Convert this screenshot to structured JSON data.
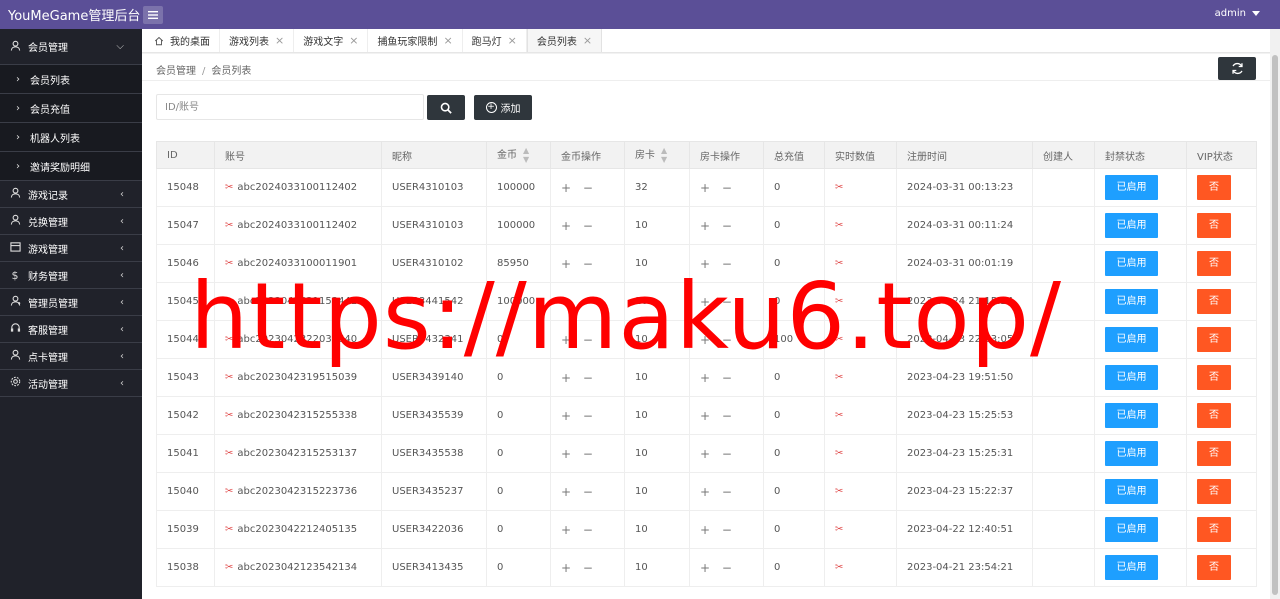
{
  "app": {
    "title": "YouMeGame管理后台",
    "user": "admin"
  },
  "sidebar": {
    "groups": [
      {
        "label": "会员管理",
        "icon": "user-icon",
        "open": true,
        "items": [
          {
            "label": "会员列表"
          },
          {
            "label": "会员充值"
          },
          {
            "label": "机器人列表"
          },
          {
            "label": "邀请奖励明细"
          }
        ]
      },
      {
        "label": "游戏记录",
        "icon": "user-icon"
      },
      {
        "label": "兑换管理",
        "icon": "user-icon"
      },
      {
        "label": "游戏管理",
        "icon": "calendar-icon"
      },
      {
        "label": "财务管理",
        "icon": "dollar-icon"
      },
      {
        "label": "管理员管理",
        "icon": "admin-icon"
      },
      {
        "label": "客服管理",
        "icon": "support-icon"
      },
      {
        "label": "点卡管理",
        "icon": "card-icon"
      },
      {
        "label": "活动管理",
        "icon": "gear-icon"
      }
    ]
  },
  "tabs": [
    {
      "label": "我的桌面",
      "home": true
    },
    {
      "label": "游戏列表"
    },
    {
      "label": "游戏文字"
    },
    {
      "label": "捕鱼玩家限制"
    },
    {
      "label": "跑马灯"
    },
    {
      "label": "会员列表",
      "active": true
    }
  ],
  "breadcrumb": {
    "parent": "会员管理",
    "separator": "/",
    "current": "会员列表"
  },
  "search": {
    "placeholder": "ID/账号",
    "add_label": "添加"
  },
  "table": {
    "columns": [
      "ID",
      "账号",
      "昵称",
      "金币",
      "金币操作",
      "房卡",
      "房卡操作",
      "总充值",
      "实时数值",
      "注册时间",
      "创建人",
      "封禁状态",
      "VIP状态"
    ],
    "rows": [
      {
        "id": "15048",
        "account": "abc2024033100112402",
        "nickname": "USER4310103",
        "gold": "100000",
        "gold_op": "+ −",
        "card": "32",
        "card_op": "+ −",
        "total": "0",
        "created": "2024-03-31 00:13:23",
        "creator": "",
        "ban": "已启用",
        "vip": "否"
      },
      {
        "id": "15047",
        "account": "abc2024033100112402",
        "nickname": "USER4310103",
        "gold": "100000",
        "gold_op": "+ −",
        "card": "10",
        "card_op": "+ −",
        "total": "0",
        "created": "2024-03-31 00:11:24",
        "creator": "",
        "ban": "已启用",
        "vip": "否"
      },
      {
        "id": "15046",
        "account": "abc2024033100011901",
        "nickname": "USER4310102",
        "gold": "85950",
        "gold_op": "+ −",
        "card": "10",
        "card_op": "+ −",
        "total": "0",
        "created": "2024-03-31 00:01:19",
        "creator": "",
        "ban": "已启用",
        "vip": "否"
      },
      {
        "id": "15045",
        "account": "abc2023042421152441",
        "nickname": "USER3441542",
        "gold": "100000",
        "gold_op": "+ −",
        "card": "10",
        "card_op": "+ −",
        "total": "0",
        "created": "2023-04-24 21:15:24",
        "creator": "",
        "ban": "已启用",
        "vip": "否"
      },
      {
        "id": "15044",
        "account": "abc2023042322030540",
        "nickname": "USER3432341",
        "gold": "0",
        "gold_op": "+ −",
        "card": "10",
        "card_op": "+ −",
        "total": "100",
        "created": "2023-04-23 22:03:05",
        "creator": "",
        "ban": "已启用",
        "vip": "否"
      },
      {
        "id": "15043",
        "account": "abc2023042319515039",
        "nickname": "USER3439140",
        "gold": "0",
        "gold_op": "+ −",
        "card": "10",
        "card_op": "+ −",
        "total": "0",
        "created": "2023-04-23 19:51:50",
        "creator": "",
        "ban": "已启用",
        "vip": "否"
      },
      {
        "id": "15042",
        "account": "abc2023042315255338",
        "nickname": "USER3435539",
        "gold": "0",
        "gold_op": "+ −",
        "card": "10",
        "card_op": "+ −",
        "total": "0",
        "created": "2023-04-23 15:25:53",
        "creator": "",
        "ban": "已启用",
        "vip": "否"
      },
      {
        "id": "15041",
        "account": "abc2023042315253137",
        "nickname": "USER3435538",
        "gold": "0",
        "gold_op": "+ −",
        "card": "10",
        "card_op": "+ −",
        "total": "0",
        "created": "2023-04-23 15:25:31",
        "creator": "",
        "ban": "已启用",
        "vip": "否"
      },
      {
        "id": "15040",
        "account": "abc2023042315223736",
        "nickname": "USER3435237",
        "gold": "0",
        "gold_op": "+ −",
        "card": "10",
        "card_op": "+ −",
        "total": "0",
        "created": "2023-04-23 15:22:37",
        "creator": "",
        "ban": "已启用",
        "vip": "否"
      },
      {
        "id": "15039",
        "account": "abc2023042212405135",
        "nickname": "USER3422036",
        "gold": "0",
        "gold_op": "+ −",
        "card": "10",
        "card_op": "+ −",
        "total": "0",
        "created": "2023-04-22 12:40:51",
        "creator": "",
        "ban": "已启用",
        "vip": "否"
      },
      {
        "id": "15038",
        "account": "abc2023042123542134",
        "nickname": "USER3413435",
        "gold": "0",
        "gold_op": "+ −",
        "card": "10",
        "card_op": "+ −",
        "total": "0",
        "created": "2023-04-21 23:54:21",
        "creator": "",
        "ban": "已启用",
        "vip": "否"
      }
    ]
  },
  "colors": {
    "header": "#5b4f97",
    "sidebar": "#20222a",
    "enabled": "#1e9fff",
    "vip_no": "#ff5722",
    "watermark": "#ff0000"
  },
  "watermark": "https://maku6.top/"
}
